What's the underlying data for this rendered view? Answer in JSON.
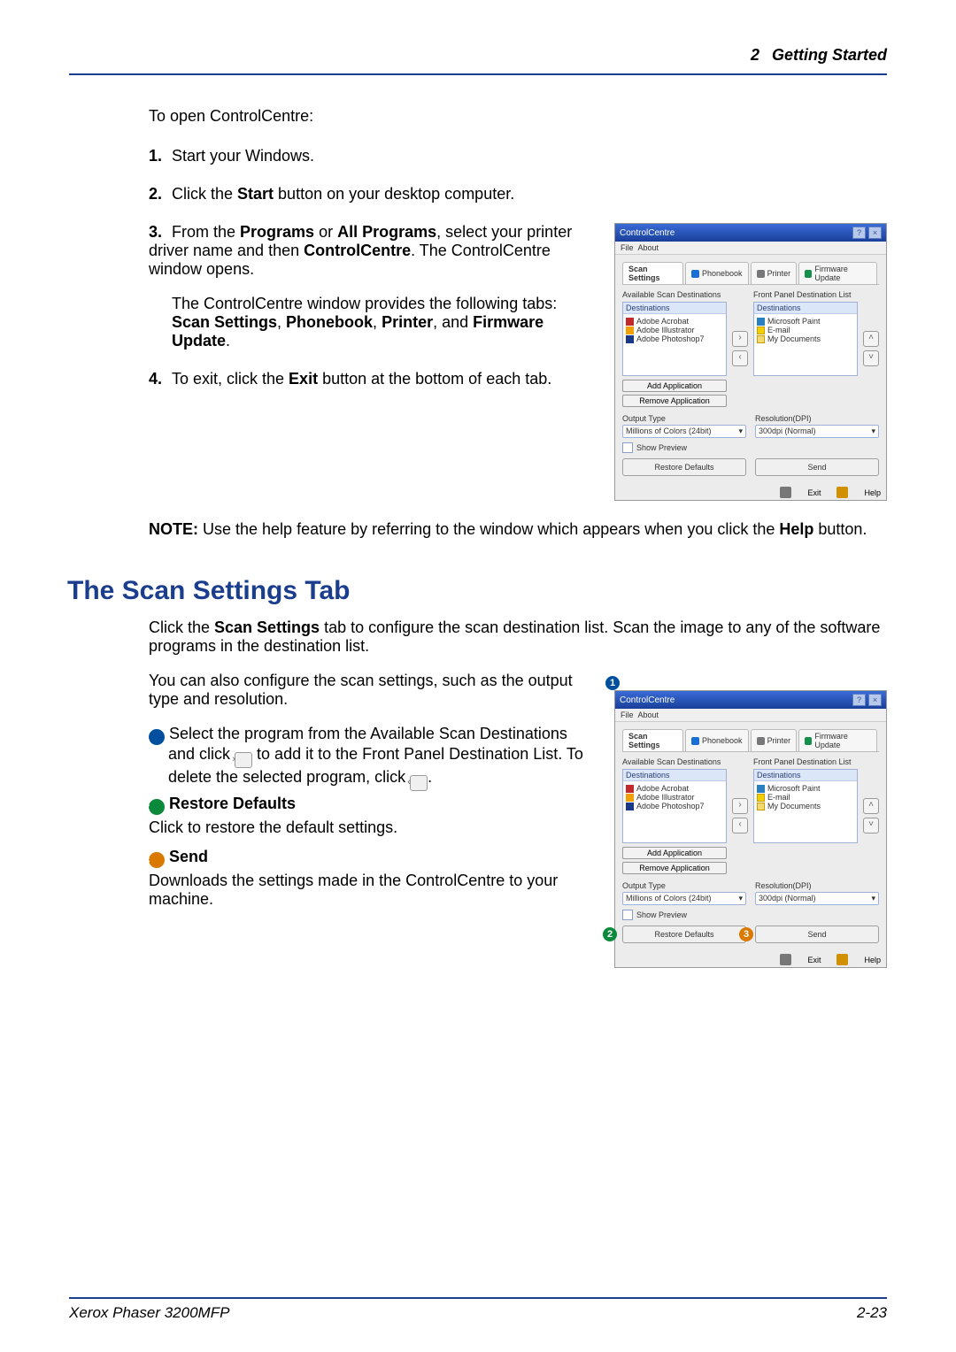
{
  "header": {
    "chapter_num": "2",
    "chapter_title": "Getting Started"
  },
  "intro": "To open ControlCentre:",
  "steps": {
    "s1": {
      "num": "1.",
      "text": "Start your Windows."
    },
    "s2": {
      "num": "2.",
      "pre": "Click the ",
      "b1": "Start",
      "post": " button on your desktop computer."
    },
    "s3": {
      "num": "3.",
      "p1a": "From the ",
      "p1b": "Programs",
      "p1c": " or ",
      "p1d": "All Programs",
      "p1e": ", select your printer driver name and then ",
      "p1f": "ControlCentre",
      "p1g": ". The ControlCentre window opens.",
      "p2a": "The ControlCentre window provides the following tabs: ",
      "p2b": "Scan Settings",
      "p2c": ", ",
      "p2d": "Phonebook",
      "p2e": ", ",
      "p2f": "Printer",
      "p2g": ", and ",
      "p2h": "Firmware Update",
      "p2i": "."
    },
    "s4": {
      "num": "4.",
      "pre": "To exit, click the ",
      "b1": "Exit",
      "post": " button at the bottom of each tab."
    }
  },
  "note": {
    "label": "NOTE:",
    "t1": " Use the help feature by referring to the window which appears when you click the ",
    "b1": "Help",
    "t2": " button."
  },
  "section": {
    "title": "The Scan Settings Tab",
    "p1a": "Click the ",
    "p1b": "Scan Settings",
    "p1c": " tab to configure the scan destination list. Scan the image to any of the software programs in the destination list.",
    "p2": "You can also configure the scan settings, such as the output type and resolution.",
    "item1": {
      "num": "1",
      "t1": " Select the program from the Available Scan Destinations and click ",
      "t2": " to add it to the Front Panel Destination List. To delete the selected program, click ",
      "t3": "."
    },
    "item2": {
      "num": "2",
      "title": "Restore Defaults",
      "text": "Click to restore the default settings."
    },
    "item3": {
      "num": "3",
      "title": "Send",
      "text": "Downloads the settings made in the ControlCentre to your machine."
    }
  },
  "win": {
    "title": "ControlCentre",
    "menu_file": "File",
    "menu_about": "About",
    "tab_scan": "Scan Settings",
    "tab_phone": "Phonebook",
    "tab_printer": "Printer",
    "tab_fw": "Firmware Update",
    "avail": "Available Scan Destinations",
    "front": "Front Panel Destination List",
    "dest": "Destinations",
    "apps": {
      "acro": "Adobe Acrobat",
      "illu": "Adobe Illustrator",
      "ps": "Adobe Photoshop7",
      "paint": "Microsoft Paint",
      "email": "E-mail",
      "docs": "My Documents"
    },
    "add": "Add Application",
    "remove": "Remove Application",
    "output": "Output Type",
    "outval": "Millions of Colors (24bit)",
    "reso": "Resolution(DPI)",
    "resoval": "300dpi (Normal)",
    "preview": "Show Preview",
    "restore": "Restore Defaults",
    "send": "Send",
    "exit": "Exit",
    "help": "Help"
  },
  "footer": {
    "left": "Xerox Phaser 3200MFP",
    "right": "2-23"
  }
}
